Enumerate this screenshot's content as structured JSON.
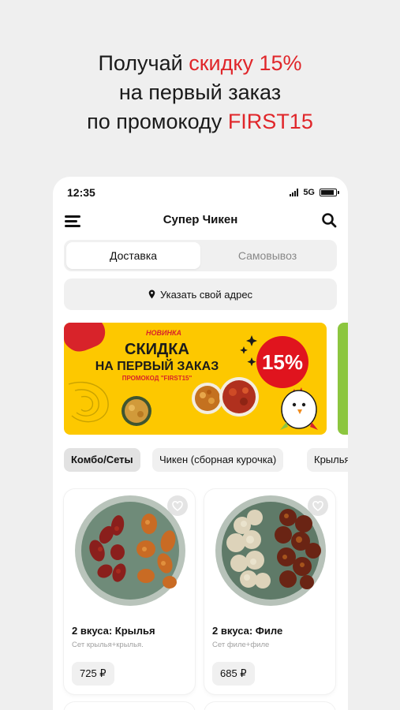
{
  "promo": {
    "line1_prefix": "Получай ",
    "line1_accent": "скидку 15%",
    "line2": "на первый заказ",
    "line3_prefix": "по промокоду ",
    "line3_accent": "FIRST15",
    "accent_color": "#e0262a"
  },
  "status_bar": {
    "time": "12:35",
    "network": "5G"
  },
  "header": {
    "title": "Супер Чикен"
  },
  "delivery_toggle": {
    "active": "Доставка",
    "inactive": "Самовывоз"
  },
  "address": {
    "label": "Указать свой адрес"
  },
  "banner": {
    "kicker": "НОВИНКА",
    "headline_1": "СКИДКА",
    "headline_2": "НА ПЕРВЫЙ ЗАКАЗ",
    "promo_line": "ПРОМОКОД \"FIRST15\"",
    "discount": "15%",
    "bg_color": "#fdc800"
  },
  "categories": [
    {
      "label": "Комбо/Сеты",
      "active": true
    },
    {
      "label": "Чикен (сборная курочка)",
      "active": false
    },
    {
      "label": "Крылья",
      "active": false
    }
  ],
  "products": [
    {
      "title": "2 вкуса: Крылья",
      "description": "Сет крылья+крылья.",
      "price": "725 ₽"
    },
    {
      "title": "2 вкуса: Филе",
      "description": "Сет филе+филе",
      "price": "685 ₽"
    }
  ],
  "icons": {
    "menu": "menu-icon",
    "search": "search-icon",
    "pin": "map-pin-icon",
    "heart": "heart-icon",
    "signal": "signal-icon",
    "battery": "battery-icon"
  }
}
